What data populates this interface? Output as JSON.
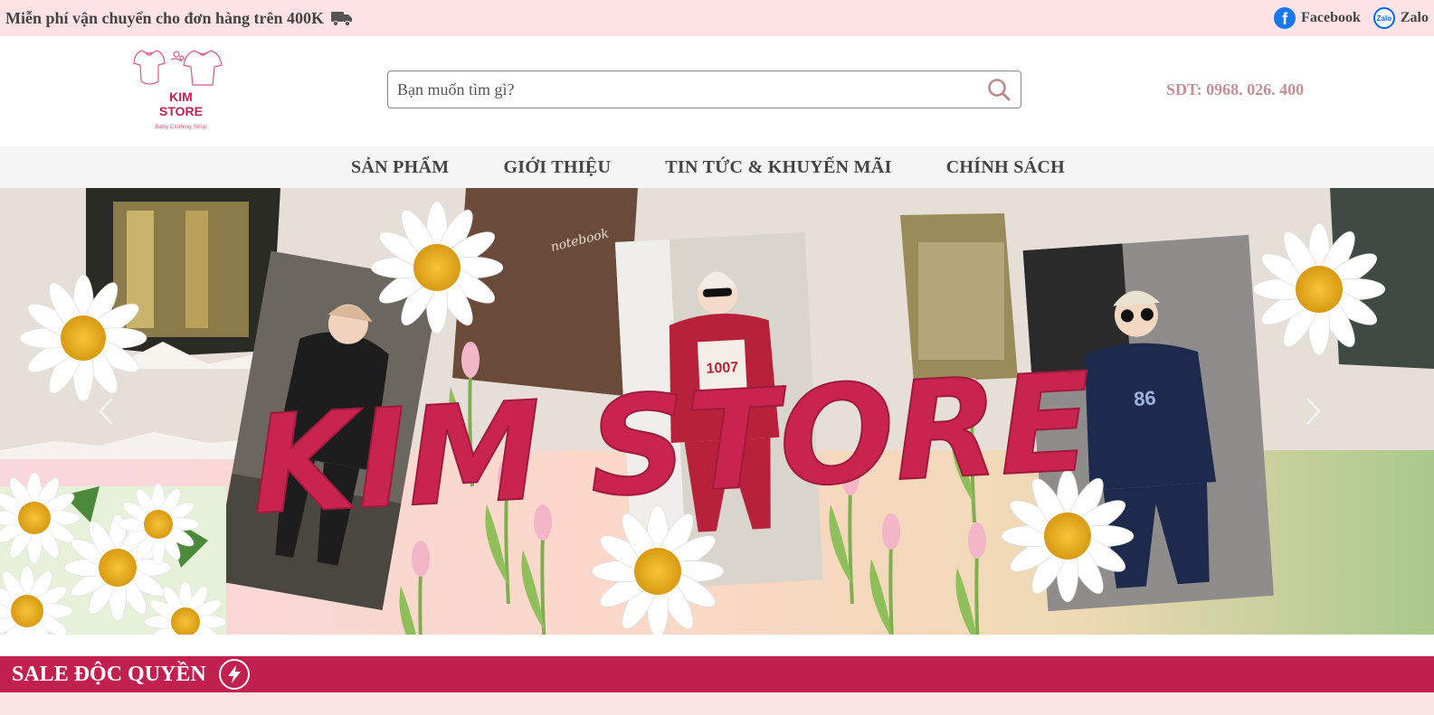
{
  "topbar": {
    "promo_text": "Miễn phí vận chuyển cho đơn hàng trên 400K",
    "facebook_label": "Facebook",
    "zalo_label": "Zalo",
    "zalo_icon_text": "Zalo"
  },
  "header": {
    "logo_line1": "KIM",
    "logo_line2": "STORE",
    "logo_tagline": "Baby Clothing Shop",
    "search_placeholder": "Bạn muốn tìm gì?",
    "phone": "SDT: 0968. 026. 400"
  },
  "nav": {
    "items": [
      "SẢN PHẨM",
      "GIỚI THIỆU",
      "TIN TỨC & KHUYẾN MÃI",
      "CHÍNH SÁCH"
    ]
  },
  "banner": {
    "title": "KIM STORE",
    "notebook_text": "notebook",
    "shirt1_text": "1007",
    "shirt2_text": "86"
  },
  "sale": {
    "title": "SALE ĐỘC QUYỀN"
  },
  "colors": {
    "topbar_bg": "#fde3e5",
    "brand": "#c2204f",
    "phone": "#c48f97",
    "nav_bg": "#f5f5f5"
  },
  "icons": [
    "truck-icon",
    "facebook-icon",
    "zalo-icon",
    "search-icon",
    "chevron-left-icon",
    "chevron-right-icon",
    "lightning-icon"
  ]
}
